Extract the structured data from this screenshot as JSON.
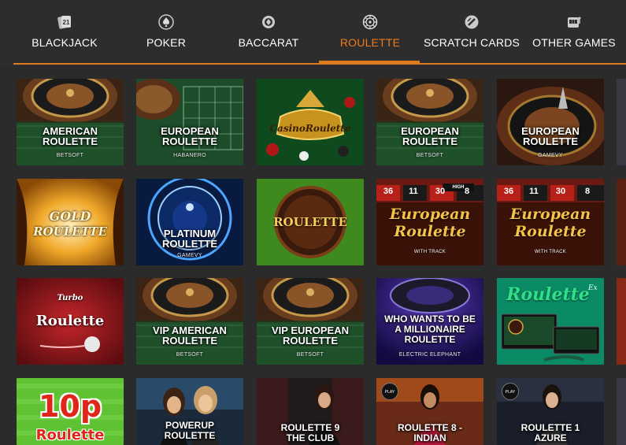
{
  "nav": {
    "tabs": [
      {
        "label": "BLACKJACK",
        "icon": "cards-21-icon"
      },
      {
        "label": "POKER",
        "icon": "spade-icon"
      },
      {
        "label": "BACCARAT",
        "icon": "baccarat-chip-icon"
      },
      {
        "label": "ROULETTE",
        "icon": "roulette-wheel-icon",
        "active": true
      },
      {
        "label": "SCRATCH CARDS",
        "icon": "scratch-coin-icon"
      },
      {
        "label": "OTHER GAMES",
        "icon": "slot-machine-icon"
      }
    ],
    "accent_color": "#e07a1f"
  },
  "games": {
    "row1": [
      {
        "title": "AMERICAN ROULETTE",
        "line1": "AMERICAN",
        "line2": "ROULETTE",
        "provider": "BETSOFT"
      },
      {
        "title": "EUROPEAN ROULETTE",
        "line1": "EUROPEAN",
        "line2": "ROULETTE",
        "provider": "HABANERO"
      },
      {
        "title": "CasinoRoulette",
        "logo_text": "CasinoRoulette"
      },
      {
        "title": "EUROPEAN ROULETTE",
        "line1": "EUROPEAN",
        "line2": "ROULETTE",
        "provider": "BETSOFT"
      },
      {
        "title": "EUROPEAN ROULETTE",
        "line1": "EUROPEAN",
        "line2": "ROULETTE",
        "provider": "GAMEVY"
      }
    ],
    "row2": [
      {
        "title": "GOLD ROULETTE",
        "logo_line1": "GOLD",
        "logo_line2": "ROULETTE"
      },
      {
        "title": "PLATINUM ROULETTE",
        "line1": "PLATINUM",
        "line2": "ROULETTE",
        "provider": "GAMEVY"
      },
      {
        "title": "ROULETTE",
        "logo_text": "ROULETTE"
      },
      {
        "title": "European Roulette",
        "logo_line1": "European",
        "logo_line2": "Roulette",
        "sub": "WITH TRACK",
        "badge": "HIGH",
        "nums": [
          "36",
          "11",
          "30",
          "8"
        ]
      },
      {
        "title": "European Roulette",
        "logo_line1": "European",
        "logo_line2": "Roulette",
        "sub": "WITH TRACK",
        "nums": [
          "36",
          "11",
          "30",
          "8"
        ]
      }
    ],
    "row3": [
      {
        "title": "Turbo Roulette",
        "logo_small": "Turbo",
        "logo_text": "Roulette"
      },
      {
        "title": "VIP AMERICAN ROULETTE",
        "line1": "VIP AMERICAN",
        "line2": "ROULETTE",
        "provider": "BETSOFT"
      },
      {
        "title": "VIP EUROPEAN ROULETTE",
        "line1": "VIP EUROPEAN",
        "line2": "ROULETTE",
        "provider": "BETSOFT"
      },
      {
        "title": "WHO WANTS TO BE A MILLIONAIRE ROULETTE",
        "line1": "WHO WANTS TO BE",
        "line2": "A MILLIONAIRE",
        "line3": "ROULETTE",
        "provider": "ELECTRIC ELEPHANT"
      },
      {
        "title": "Roulette Ex",
        "logo_text": "Roulette",
        "logo_sup": "Ex"
      }
    ],
    "row4": [
      {
        "title": "10p Roulette",
        "logo_line1": "10p",
        "logo_line2": "Roulette"
      },
      {
        "title": "POWERUP ROULETTE",
        "line1": "POWERUP",
        "line2": "ROULETTE"
      },
      {
        "title": "ROULETTE 9 THE CLUB",
        "line1": "ROULETTE 9",
        "line2": "THE CLUB"
      },
      {
        "title": "ROULETTE 8 - INDIAN",
        "line1": "ROULETTE 8 -",
        "line2": "INDIAN",
        "play": "PLAY"
      },
      {
        "title": "ROULETTE 1 AZURE",
        "line1": "ROULETTE 1",
        "line2": "AZURE",
        "play": "PLAY"
      }
    ]
  }
}
